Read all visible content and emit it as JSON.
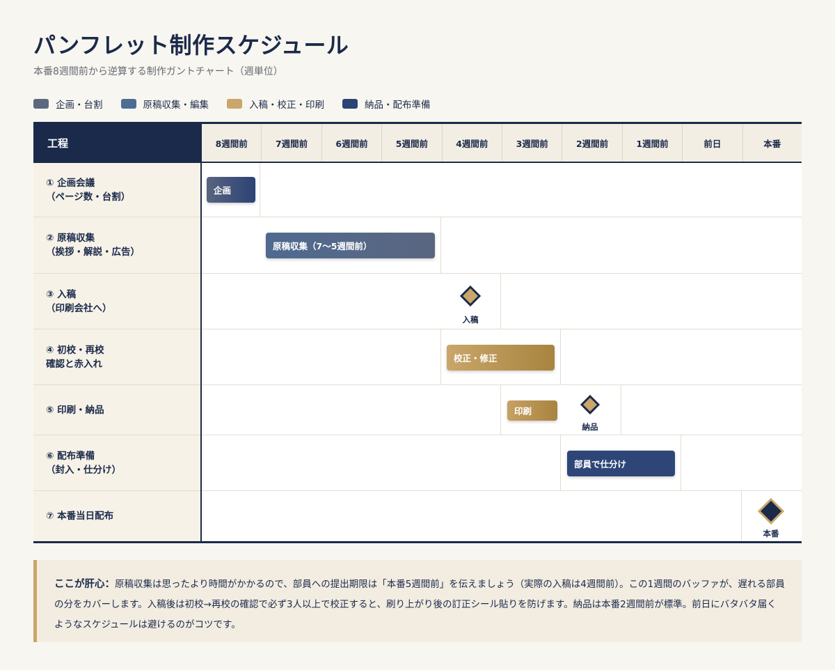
{
  "title": "パンフレット制作スケジュール",
  "subtitle": "本番8週間前から逆算する制作ガントチャート（週単位）",
  "legend": [
    {
      "label": "企画・台割",
      "color": "#5b6880"
    },
    {
      "label": "原稿収集・編集",
      "color": "#4e6d94"
    },
    {
      "label": "入稿・校正・印刷",
      "color": "#c9a66a"
    },
    {
      "label": "納品・配布準備",
      "color": "#2c4474"
    }
  ],
  "header": {
    "process_label": "工程",
    "weeks": [
      "8週間前",
      "7週間前",
      "6週間前",
      "5週間前",
      "4週間前",
      "3週間前",
      "2週間前",
      "1週間前",
      "前日",
      "本番"
    ]
  },
  "rows": [
    {
      "line1": "① 企画会議",
      "line2": "（ページ数・台割）"
    },
    {
      "line1": "② 原稿収集",
      "line2": "（挨拶・解説・広告）"
    },
    {
      "line1": "③ 入稿",
      "line2": "（印刷会社へ）"
    },
    {
      "line1": "④ 初校・再校",
      "line2": "確認と赤入れ"
    },
    {
      "line1": "⑤ 印刷・納品",
      "line2": ""
    },
    {
      "line1": "⑥ 配布準備",
      "line2": "（封入・仕分け）"
    },
    {
      "line1": "⑦ 本番当日配布",
      "line2": ""
    }
  ],
  "tasks": {
    "plan": "企画",
    "draft": "原稿収集（7〜5週間前）",
    "proof": "校正・修正",
    "print": "印刷",
    "prep": "部員で仕分け"
  },
  "milestones": {
    "submit": "入稿",
    "delivery": "納品",
    "showday": "本番"
  },
  "note": {
    "label": "ここが肝心：",
    "text": "原稿収集は思ったより時間がかかるので、部員への提出期限は「本番5週間前」を伝えましょう（実際の入稿は4週間前）。この1週間のバッファが、遅れる部員の分をカバーします。入稿後は初校→再校の確認で必ず3人以上で校正すると、刷り上がり後の訂正シール貼りを防げます。納品は本番2週間前が標準。前日にバタバタ届くようなスケジュールは避けるのがコツです。"
  },
  "colors": {
    "navy": "#1b2a4a",
    "gold": "#c9a66a",
    "background": "#f8f6f0"
  }
}
